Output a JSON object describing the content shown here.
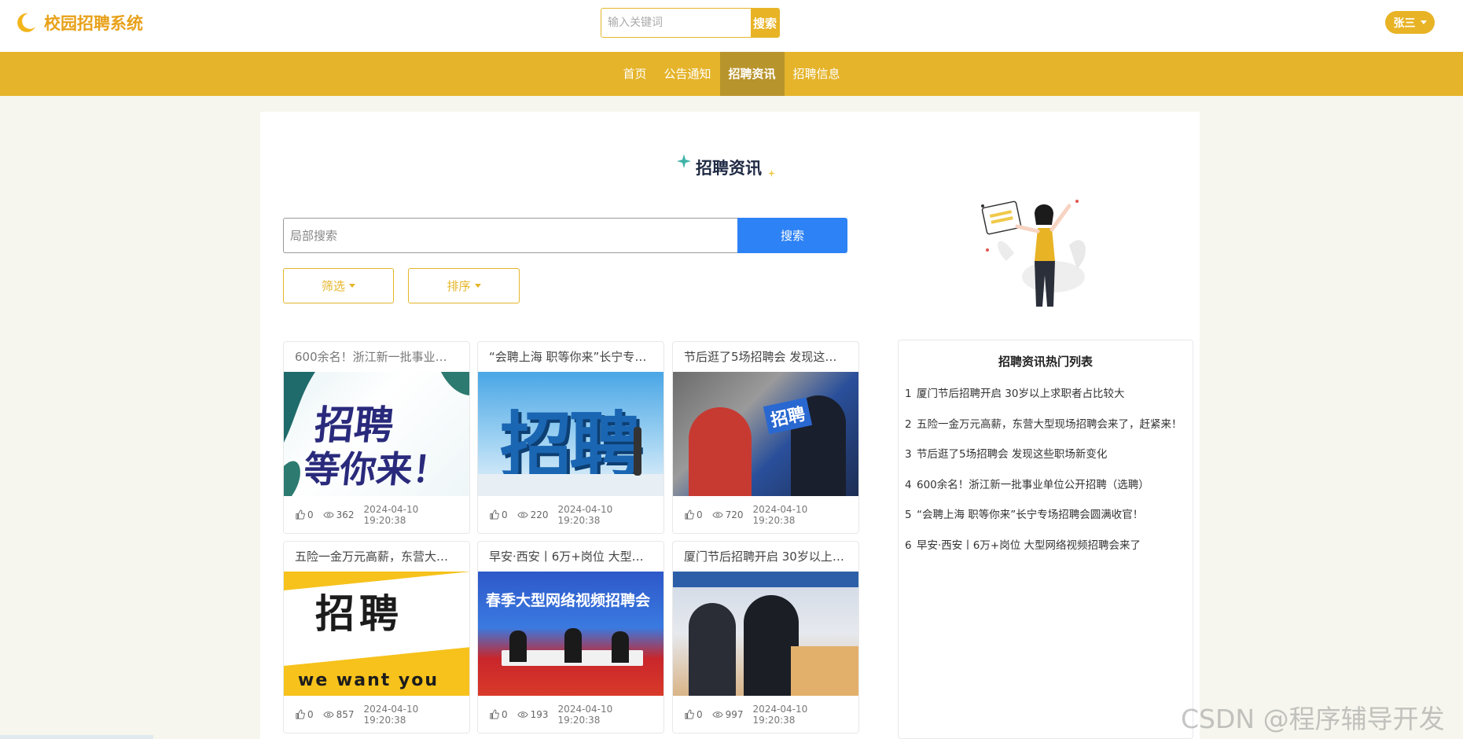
{
  "header": {
    "app_title": "校园招聘系统",
    "search_placeholder": "输入关键词",
    "search_button": "搜索",
    "user_name": "张三"
  },
  "nav": {
    "items": [
      {
        "label": "首页",
        "active": false
      },
      {
        "label": "公告通知",
        "active": false
      },
      {
        "label": "招聘资讯",
        "active": true
      },
      {
        "label": "招聘信息",
        "active": false
      }
    ]
  },
  "main": {
    "section_title": "招聘资讯",
    "local_search_placeholder": "局部搜索",
    "local_search_button": "搜索",
    "filter_label": "筛选",
    "sort_label": "排序"
  },
  "cards": [
    {
      "title": "600余名！浙江新一批事业单位公开招聘（选聘）",
      "likes": "0",
      "views": "362",
      "date": "2024-04-10 19:20:38",
      "image_text": [
        "招聘",
        "等你来！"
      ]
    },
    {
      "title": "“会聘上海 职等你来”长宁专场招聘会圆满收官！",
      "likes": "0",
      "views": "220",
      "date": "2024-04-10 19:20:38",
      "image_text": [
        "招聘"
      ]
    },
    {
      "title": "节后逛了5场招聘会 发现这些职场新变化",
      "likes": "0",
      "views": "720",
      "date": "2024-04-10 19:20:38",
      "image_text": [
        "招聘"
      ]
    },
    {
      "title": "五险一金万元高薪，东营大型现场招聘会来了，赶紧来！",
      "likes": "0",
      "views": "857",
      "date": "2024-04-10 19:20:38",
      "image_text": [
        "招聘",
        "we want you"
      ]
    },
    {
      "title": "早安·西安丨6万+岗位 大型网络视频招聘会来了",
      "likes": "0",
      "views": "193",
      "date": "2024-04-10 19:20:38",
      "image_text": [
        "春季大型网络视频招聘会"
      ]
    },
    {
      "title": "厦门节后招聘开启 30岁以上求职者占比较大",
      "likes": "0",
      "views": "997",
      "date": "2024-04-10 19:20:38",
      "image_text": []
    }
  ],
  "hot_list": {
    "title": "招聘资讯热门列表",
    "items": [
      {
        "rank": "1",
        "text": "厦门节后招聘开启 30岁以上求职者占比较大"
      },
      {
        "rank": "2",
        "text": "五险一金万元高薪，东营大型现场招聘会来了，赶紧来！"
      },
      {
        "rank": "3",
        "text": "节后逛了5场招聘会 发现这些职场新变化"
      },
      {
        "rank": "4",
        "text": "600余名！浙江新一批事业单位公开招聘（选聘）"
      },
      {
        "rank": "5",
        "text": "“会聘上海 职等你来”长宁专场招聘会圆满收官！"
      },
      {
        "rank": "6",
        "text": "早安·西安丨6万+岗位 大型网络视频招聘会来了"
      }
    ]
  },
  "watermark": "CSDN @程序辅导开发",
  "colors": {
    "accent": "#e5b42b",
    "nav_active": "#b8942c",
    "primary_blue": "#2d82f5"
  }
}
